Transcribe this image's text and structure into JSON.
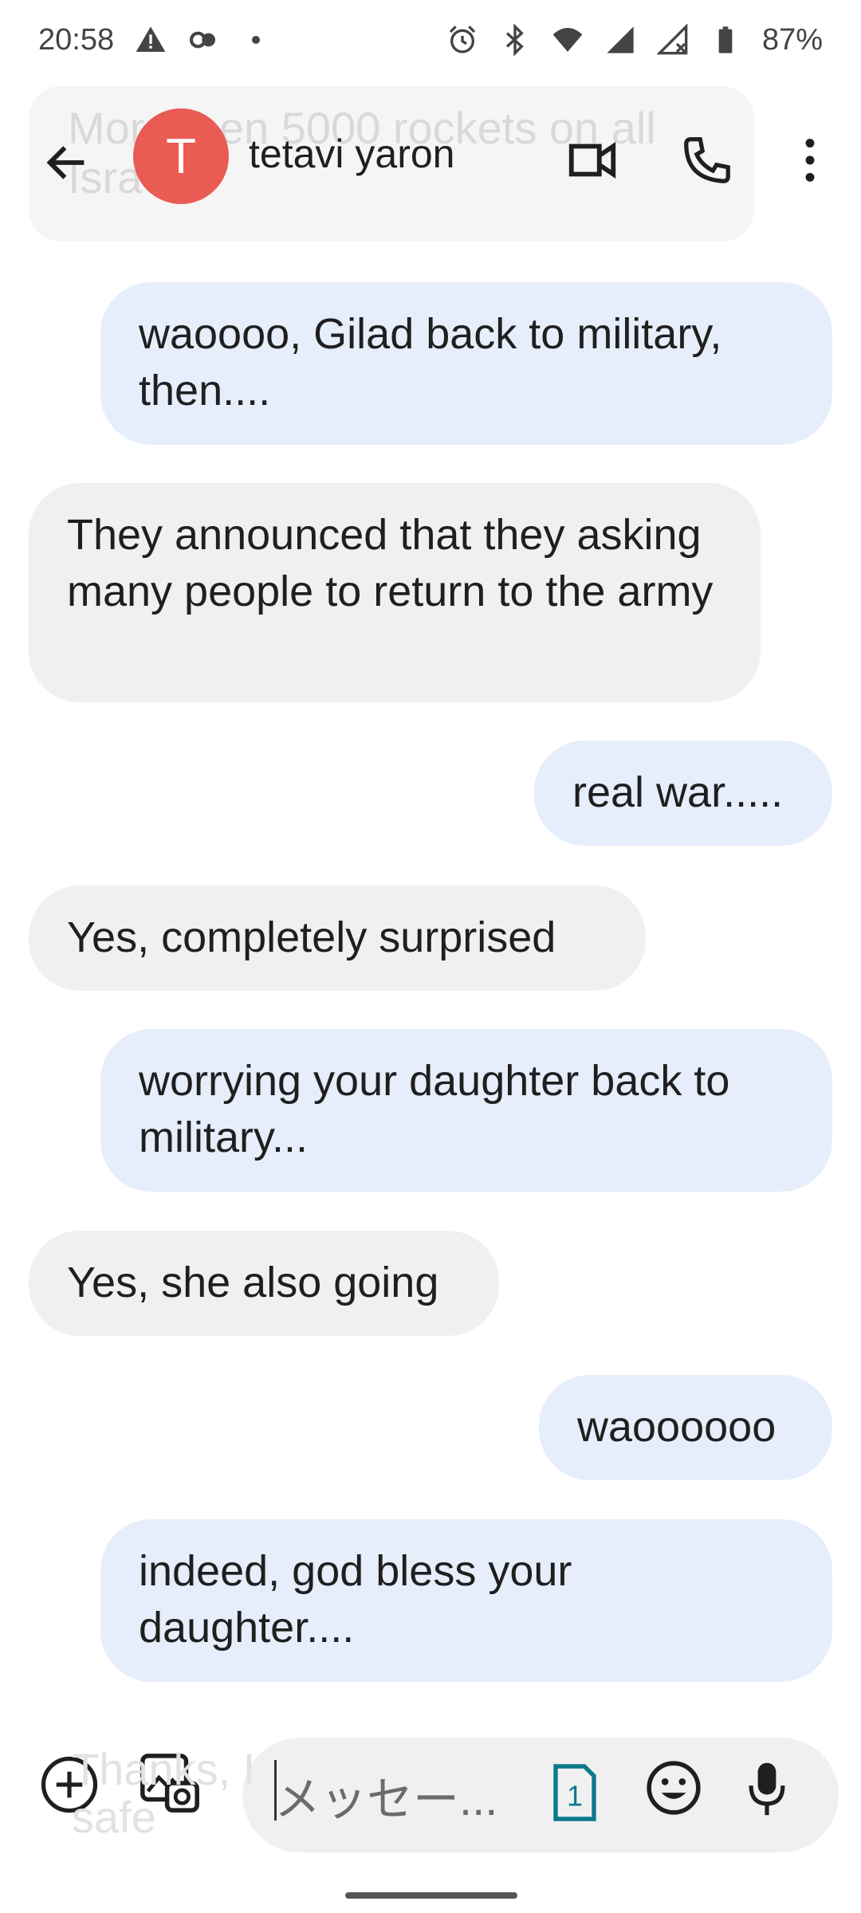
{
  "status_bar": {
    "time": "20:58",
    "battery": "87%",
    "icons": [
      "warning-icon",
      "link-icon",
      "dot-icon",
      "alarm-icon",
      "bluetooth-icon",
      "wifi-icon",
      "signal-icon",
      "signal-off-icon",
      "battery-icon"
    ]
  },
  "background": {
    "ghost_message": "More then 5000 rockets on all Israel",
    "ghost_composer": "Thanks, I\nsafe"
  },
  "header": {
    "avatar_letter": "T",
    "avatar_color": "#ea5b54",
    "contact_name": "tetavi yaron",
    "icons": [
      "back-arrow-icon",
      "video-call-icon",
      "phone-icon",
      "more-vert-icon"
    ]
  },
  "messages": [
    {
      "from": "me",
      "text": "waoooo, Gilad back to military, then...."
    },
    {
      "from": "them",
      "text": "They announced that they asking many people to return to the army"
    },
    {
      "from": "me",
      "text": "real war....."
    },
    {
      "from": "them",
      "text": "Yes, completely surprised"
    },
    {
      "from": "me",
      "text": "worrying your daughter back to military..."
    },
    {
      "from": "them",
      "text": "Yes, she also going"
    },
    {
      "from": "me",
      "text": "waoooooo"
    },
    {
      "from": "me",
      "text": "indeed, god bless your daughter...."
    }
  ],
  "composer": {
    "placeholder": "メッセー...",
    "sim_number": "1",
    "icons": [
      "add-icon",
      "gallery-icon",
      "sim-icon",
      "emoji-icon",
      "mic-icon"
    ]
  },
  "colors": {
    "sent_bubble": "#e6edfb",
    "received_bubble": "#f0f0f0",
    "sim_accent": "#0b7a8a"
  }
}
